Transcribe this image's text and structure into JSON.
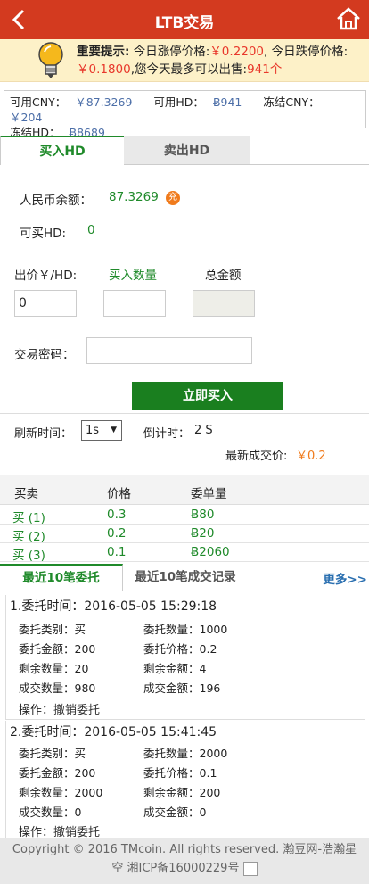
{
  "header": {
    "title": "LTB交易"
  },
  "notice": {
    "label": "重要提示:",
    "text1": "今日涨停价格:",
    "up_price": "￥0.2200",
    "text2": ", 今日跌停价格:",
    "down_price": "￥0.1800",
    "text3": ",您今天最多可以出售:",
    "max_sell": "941个"
  },
  "balances": {
    "cny_label": "可用CNY：",
    "cny_value": "￥87.3269",
    "hd_label": "可用HD：",
    "hd_value": "Ƀ941",
    "frozen_cny_label": "冻结CNY：",
    "frozen_cny_value": "￥204",
    "frozen_hd_label": "冻结HD：",
    "frozen_hd_value": "Ƀ8689"
  },
  "tabs": {
    "buy": "买入HD",
    "sell": "卖出HD"
  },
  "form": {
    "rmb_label": "人民币余额：",
    "rmb_value": "87.3269",
    "recharge": "充",
    "can_buy_label": "可买HD:",
    "can_buy_value": "0",
    "price_label": "出价￥/HD:",
    "qty_label": "买入数量",
    "total_label": "总金额",
    "price_value": "0",
    "qty_value": "",
    "total_value": "",
    "pwd_label": "交易密码：",
    "buy_button": "立即买入"
  },
  "refresh": {
    "label": "刷新时间：",
    "selected": "1s",
    "countdown_label": "倒计时：",
    "countdown_value": "2 S",
    "latest_label": "最新成交价:",
    "latest_value": "￥0.2"
  },
  "orderbook": {
    "headers": [
      "买卖",
      "价格",
      "委单量"
    ],
    "rows": [
      {
        "side": "买 (1)",
        "price": "0.3",
        "amount": "Ƀ80"
      },
      {
        "side": "买 (2)",
        "price": "0.2",
        "amount": "Ƀ20"
      },
      {
        "side": "买 (3)",
        "price": "0.1",
        "amount": "Ƀ2060"
      }
    ]
  },
  "records_tabs": {
    "recent_orders": "最近10笔委托",
    "recent_trades": "最近10笔成交记录",
    "more": "更多>>"
  },
  "records": [
    {
      "title": "1.委托时间：2016-05-05 15:29:18",
      "type_label": "委托类别：",
      "type": "买",
      "qty_label": "委托数量：",
      "qty": "1000",
      "amount_label": "委托金额：",
      "amount": "200",
      "price_label": "委托价格：",
      "price": "0.2",
      "remain_qty_label": "剩余数量：",
      "remain_qty": "20",
      "remain_amount_label": "剩余金额：",
      "remain_amount": "4",
      "deal_qty_label": "成交数量：",
      "deal_qty": "980",
      "deal_amount_label": "成交金额：",
      "deal_amount": "196",
      "op_label": "操作：",
      "op": "撤销委托"
    },
    {
      "title": "2.委托时间：2016-05-05 15:41:45",
      "type_label": "委托类别：",
      "type": "买",
      "qty_label": "委托数量：",
      "qty": "2000",
      "amount_label": "委托金额：",
      "amount": "200",
      "price_label": "委托价格：",
      "price": "0.1",
      "remain_qty_label": "剩余数量：",
      "remain_qty": "2000",
      "remain_amount_label": "剩余金额：",
      "remain_amount": "200",
      "deal_qty_label": "成交数量：",
      "deal_qty": "0",
      "deal_amount_label": "成交金额：",
      "deal_amount": "0",
      "op_label": "操作：",
      "op": "撤销委托"
    }
  ],
  "footer": {
    "line1": "Copyright © 2016 TMcoin. All rights reserved. 瀚豆网-浩瀚星空 湘ICP备16000229号"
  },
  "colors": {
    "header": "#d33a1f",
    "accent_green": "#1f8a2a",
    "price_red": "#e8382b",
    "notice_bg": "#fdf1c8"
  },
  "icons": [
    "back-arrow-icon",
    "home-icon",
    "lightbulb-icon",
    "dropdown-arrow-icon",
    "broken-image-icon"
  ]
}
